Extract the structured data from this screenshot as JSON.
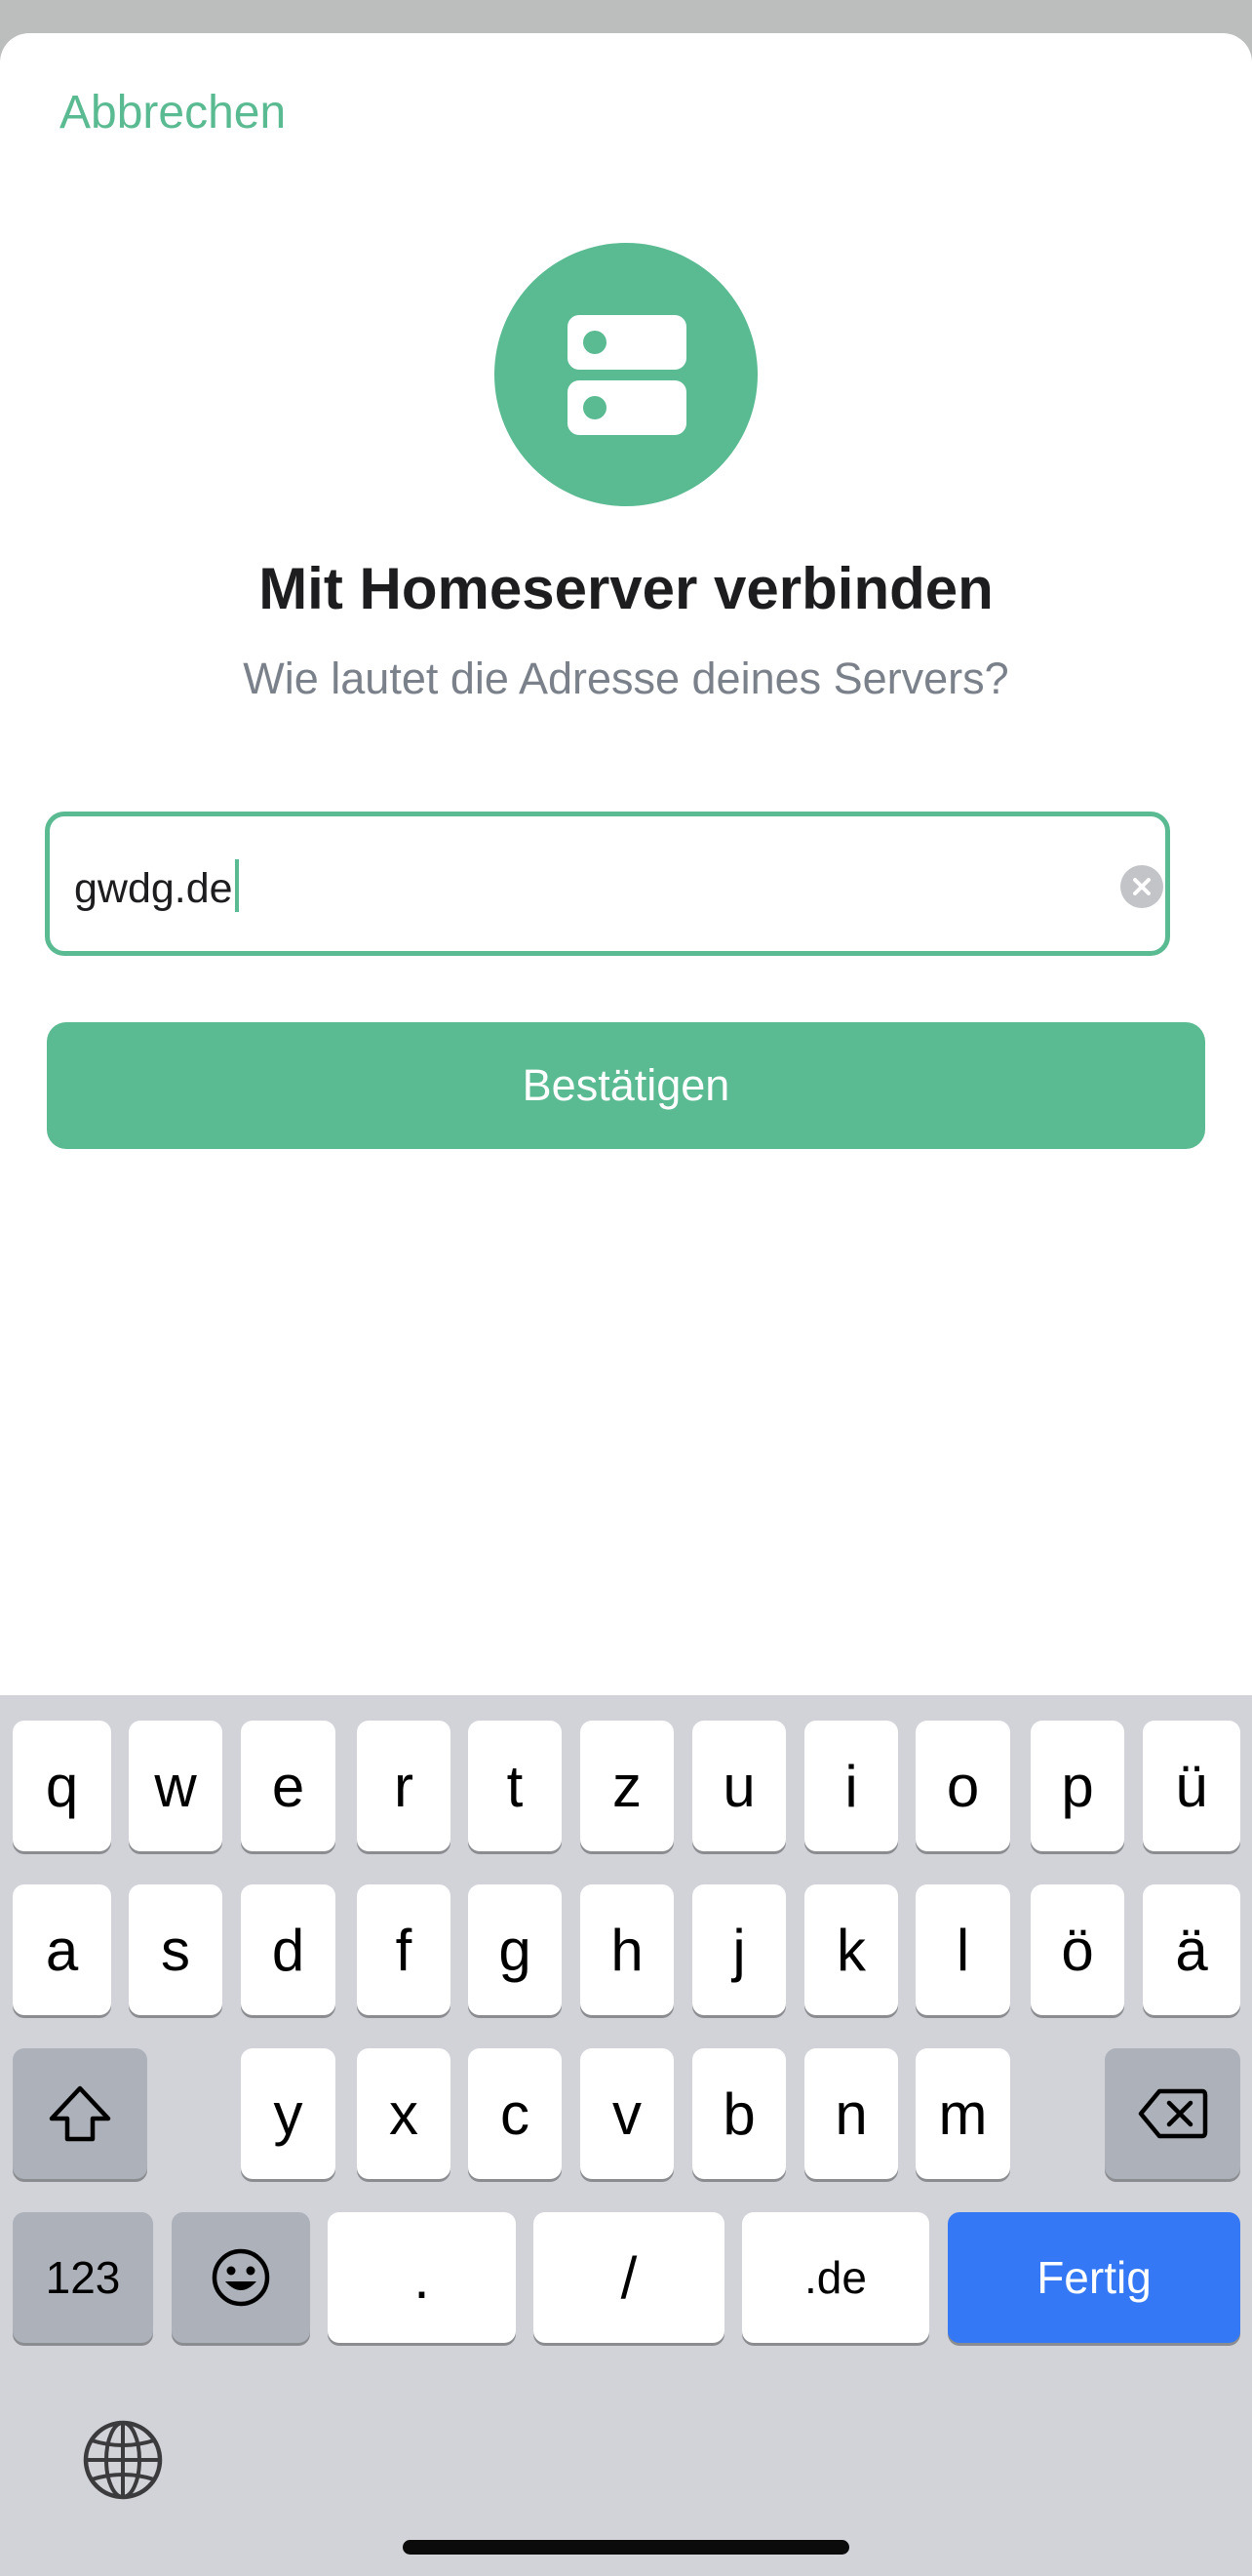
{
  "header": {
    "cancel_label": "Abbrechen"
  },
  "logo": {
    "icon": "server-icon",
    "color": "#5aba91"
  },
  "title": "Mit Homeserver verbinden",
  "subtitle": "Wie lautet die Adresse deines Servers?",
  "server_field": {
    "value": "gwdg.de",
    "clear_icon": "clear-icon"
  },
  "confirm_label": "Bestätigen",
  "keyboard": {
    "row1": [
      "q",
      "w",
      "e",
      "r",
      "t",
      "z",
      "u",
      "i",
      "o",
      "p",
      "ü"
    ],
    "row2": [
      "a",
      "s",
      "d",
      "f",
      "g",
      "h",
      "j",
      "k",
      "l",
      "ö",
      "ä"
    ],
    "row3": [
      "y",
      "x",
      "c",
      "v",
      "b",
      "n",
      "m"
    ],
    "shift_icon": "shift-icon",
    "backspace_icon": "backspace-icon",
    "numbers_label": "123",
    "emoji_icon": "emoji-icon",
    "dot_label": ".",
    "slash_label": "/",
    "domain_label": ".de",
    "done_label": "Fertig",
    "globe_icon": "globe-icon"
  },
  "colors": {
    "accent": "#5aba91",
    "done_key": "#3478f6",
    "keyboard_bg": "#d1d3d9"
  }
}
